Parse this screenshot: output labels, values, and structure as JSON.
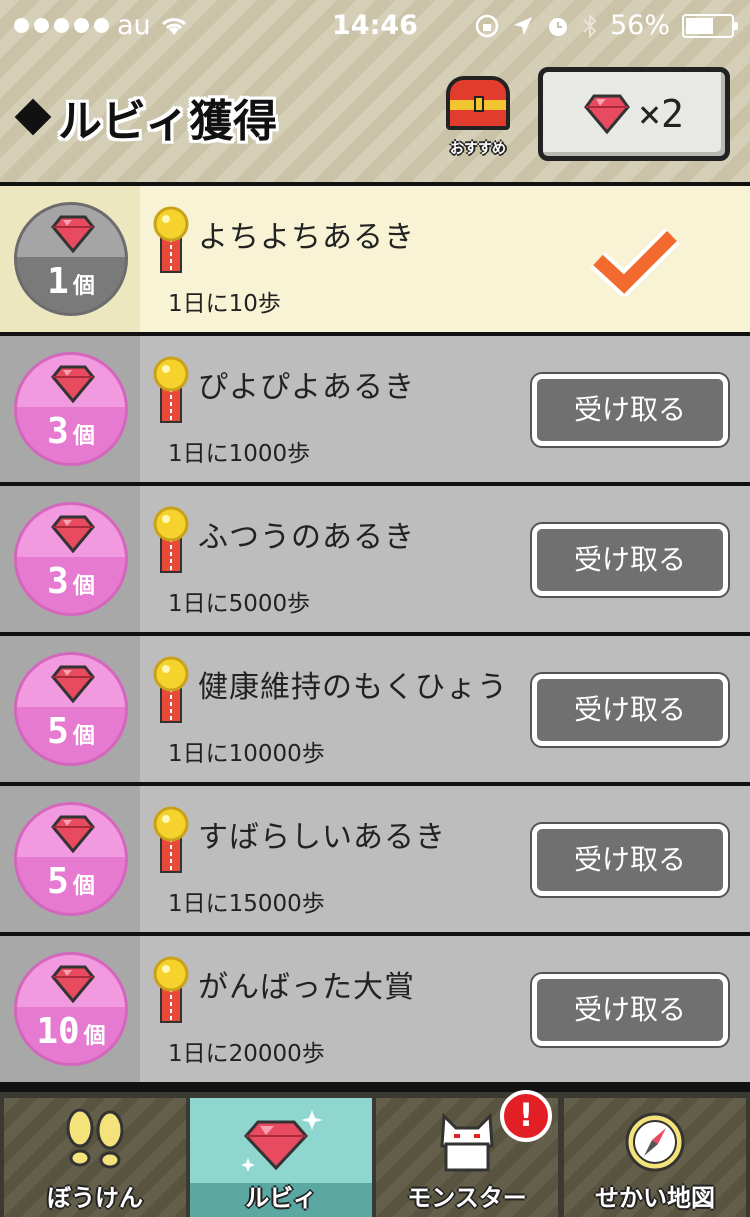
{
  "status_bar": {
    "carrier": "au",
    "time": "14:46",
    "battery": "56%"
  },
  "header": {
    "title": "ルビィ獲得",
    "recommend_label": "おすすめ",
    "gem_count": "×2"
  },
  "rewards": [
    {
      "title": "よちよちあるき",
      "requirement": "1日に10歩",
      "reward_num": "1",
      "reward_unit": "個",
      "state": "claimed"
    },
    {
      "title": "ぴよぴよあるき",
      "requirement": "1日に1000歩",
      "reward_num": "3",
      "reward_unit": "個",
      "state": "claimable",
      "button": "受け取る"
    },
    {
      "title": "ふつうのあるき",
      "requirement": "1日に5000歩",
      "reward_num": "3",
      "reward_unit": "個",
      "state": "claimable",
      "button": "受け取る"
    },
    {
      "title": "健康維持のもくひょう",
      "requirement": "1日に10000歩",
      "reward_num": "5",
      "reward_unit": "個",
      "state": "claimable",
      "button": "受け取る"
    },
    {
      "title": "すばらしいあるき",
      "requirement": "1日に15000歩",
      "reward_num": "5",
      "reward_unit": "個",
      "state": "claimable",
      "button": "受け取る"
    },
    {
      "title": "がんばった大賞",
      "requirement": "1日に20000歩",
      "reward_num": "10",
      "reward_unit": "個",
      "state": "claimable",
      "button": "受け取る"
    }
  ],
  "tabs": [
    {
      "label": "ぼうけん",
      "icon": "footprints-icon"
    },
    {
      "label": "ルビィ",
      "icon": "ruby-icon",
      "active": true
    },
    {
      "label": "モンスター",
      "icon": "cat-monster-icon"
    },
    {
      "label": "せかい地図",
      "icon": "compass-icon"
    }
  ],
  "alert_badge": "!",
  "colors": {
    "ruby": "#e84a5f",
    "pink_reward": "#e67ad0",
    "check": "#f26a2e",
    "active_tab": "#8fd6cf"
  }
}
